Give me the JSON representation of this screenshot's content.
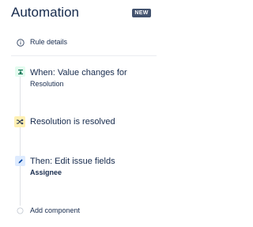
{
  "header": {
    "title": "Automation",
    "badge": "NEW"
  },
  "steps": [
    {
      "icon": "info-icon",
      "label": "Rule details"
    },
    {
      "icon": "trigger-icon",
      "label": "When: Value changes for",
      "detail": "Resolution",
      "color": "#36b37e"
    },
    {
      "icon": "shuffle-icon",
      "label": "Resolution is resolved",
      "color": "#ffab00"
    },
    {
      "icon": "pencil-icon",
      "label": "Then: Edit issue fields",
      "detail": "Assignee",
      "color": "#0065ff"
    },
    {
      "icon": "circle-icon",
      "label": "Add component"
    }
  ]
}
